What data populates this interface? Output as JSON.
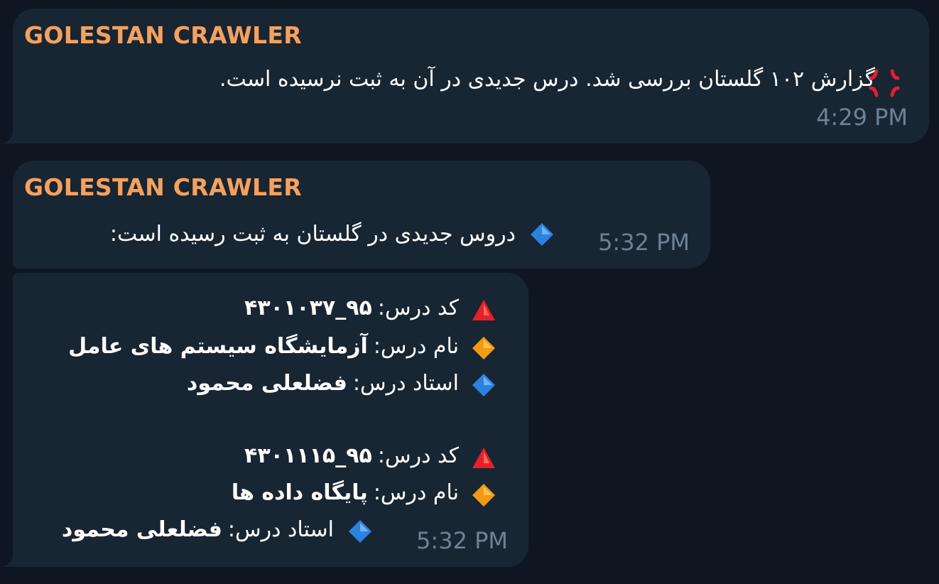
{
  "messages": [
    {
      "sender": "GOLESTAN CRAWLER",
      "icon": "anger-emoji",
      "text": "گزارش ۱۰۲ گلستان بررسی شد. درس جدیدی در آن به ثبت نرسیده است.",
      "time": "4:29 PM"
    },
    {
      "sender": "GOLESTAN CRAWLER",
      "icon": "blue-diamond-emoji",
      "text": "دروس جدیدی در گلستان به ثبت رسیده است:",
      "time": "5:32 PM"
    },
    {
      "courses": [
        {
          "code_label": "کد درس:",
          "code": "۹۵_۴۳۰۱۰۳۷",
          "name_label": "نام درس:",
          "name": "آزمایشگاه سیستم های عامل",
          "teacher_label": "استاد درس:",
          "teacher": "فضلعلی محمود"
        },
        {
          "code_label": "کد درس:",
          "code": "۹۵_۴۳۰۱۱۱۵",
          "name_label": "نام درس:",
          "name": "پایگاه داده ها",
          "teacher_label": "استاد درس:",
          "teacher": "فضلعلی محمود"
        }
      ],
      "time": "5:32 PM"
    }
  ],
  "icons": {
    "code": "red-triangle-icon",
    "name": "orange-diamond-icon",
    "teacher": "blue-diamond-icon"
  },
  "colors": {
    "background": "#0e1621",
    "bubble": "#182533",
    "sender": "#f5a15e",
    "time": "#6e8294",
    "text": "#ffffff"
  }
}
